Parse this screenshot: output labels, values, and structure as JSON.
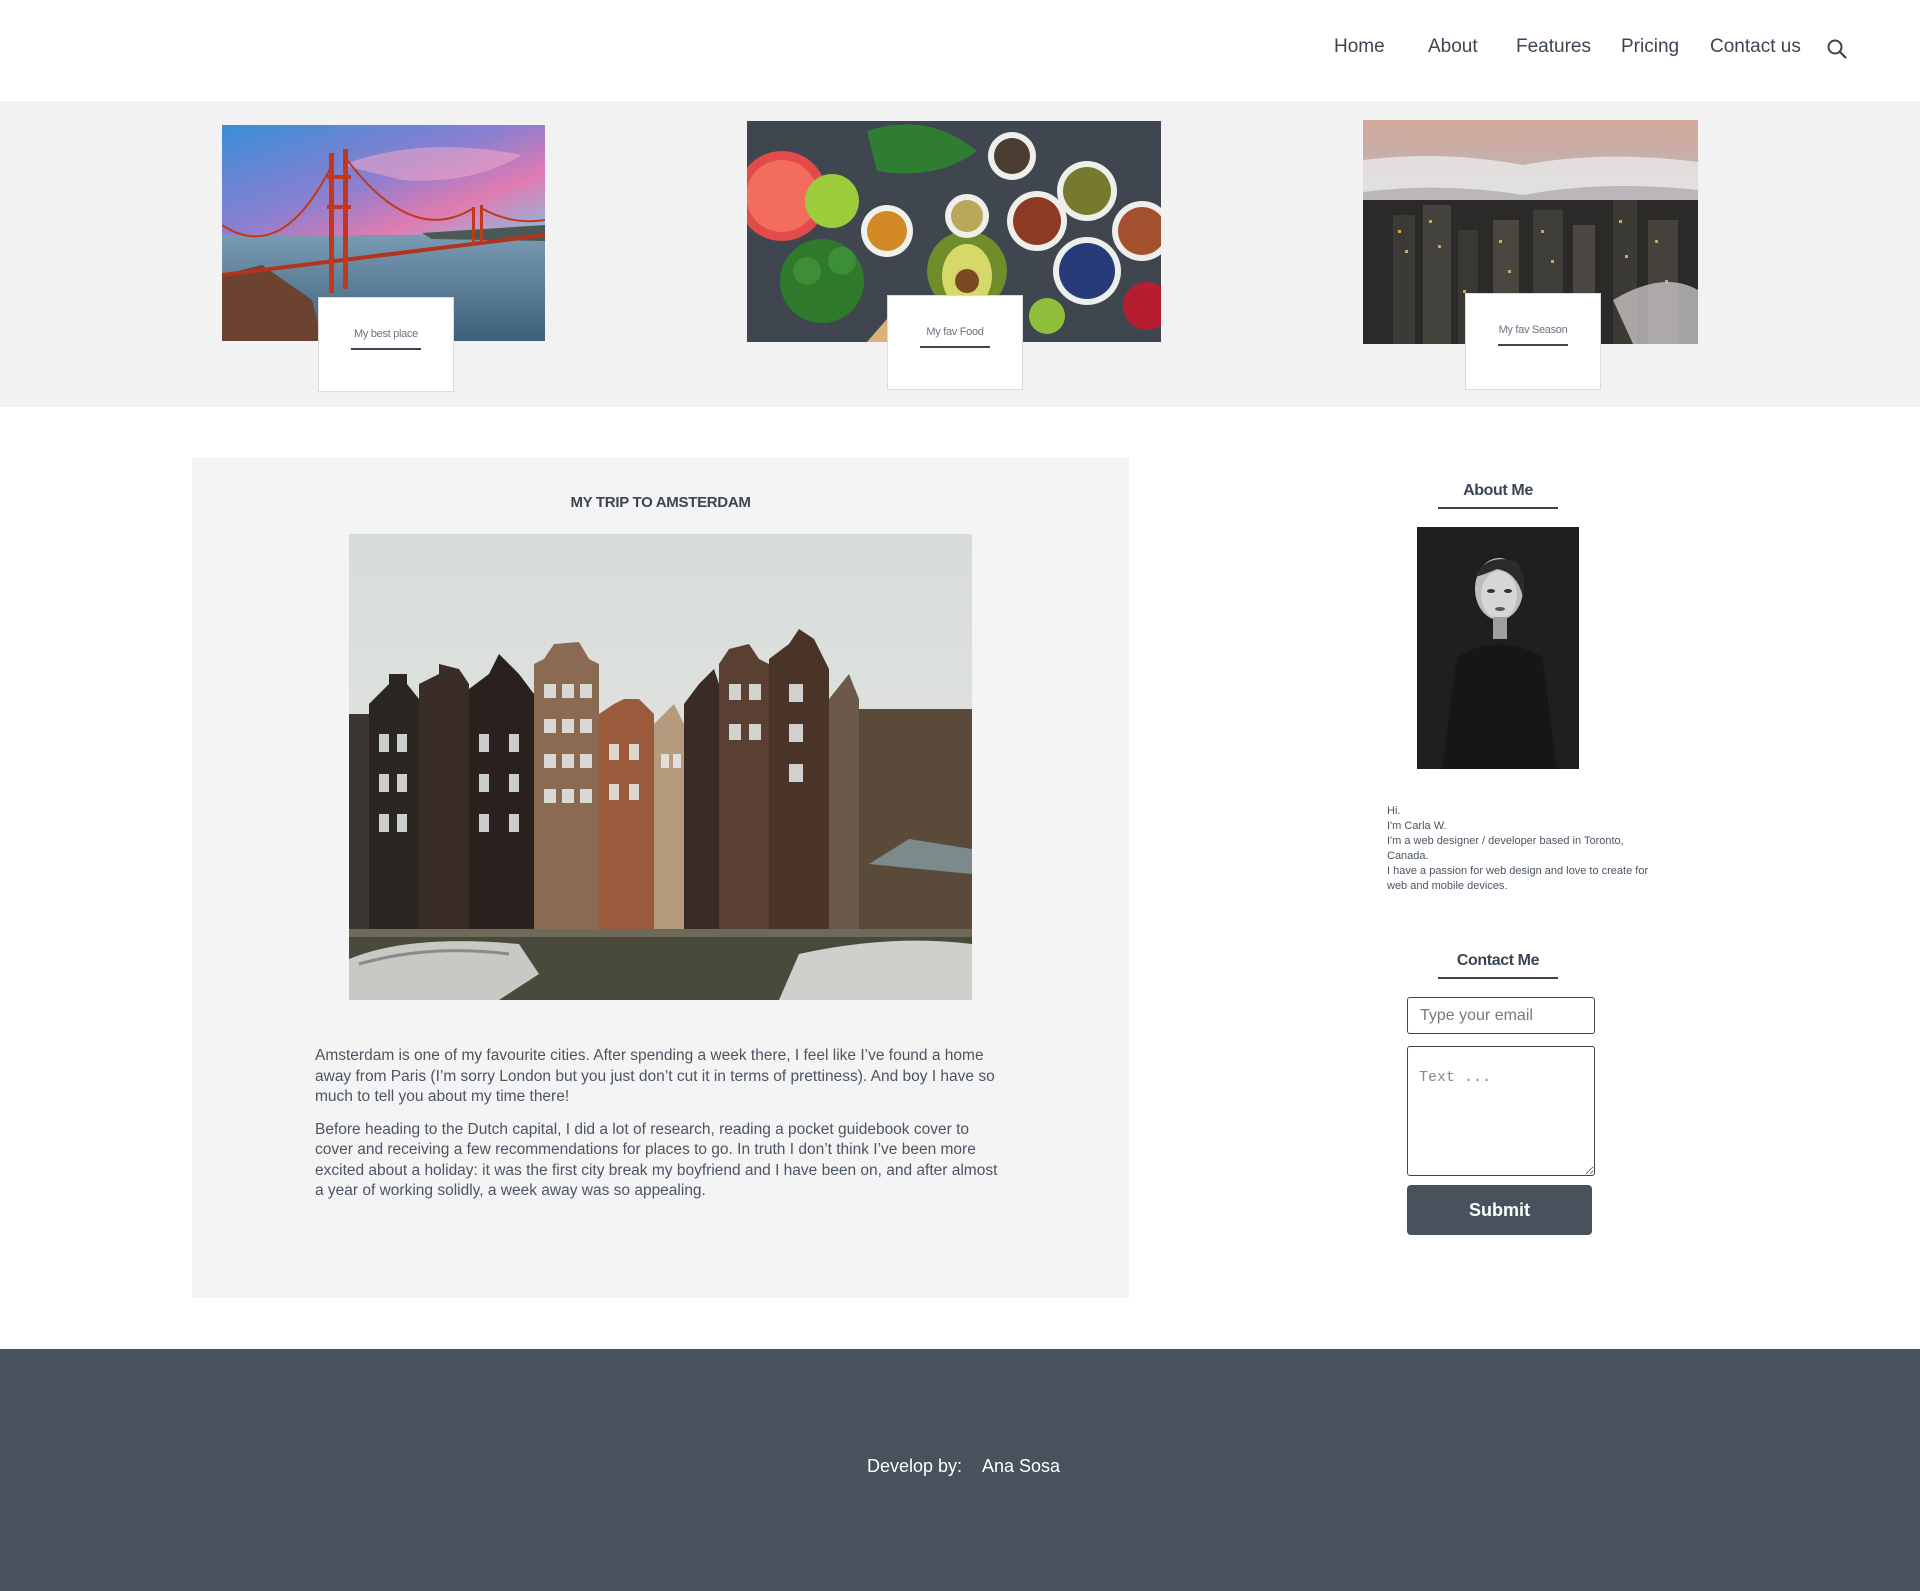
{
  "nav": {
    "items": [
      {
        "label": "Home"
      },
      {
        "label": "About"
      },
      {
        "label": "Features"
      },
      {
        "label": "Pricing"
      },
      {
        "label": "Contact us"
      }
    ],
    "search_icon": "search-icon"
  },
  "featured": {
    "cards": [
      {
        "label": "My best place",
        "image": "golden-gate-bridge-image"
      },
      {
        "label": "My fav Food",
        "image": "healthy-food-image"
      },
      {
        "label": "My fav Season",
        "image": "foggy-city-image"
      }
    ]
  },
  "article": {
    "title": "MY TRIP TO AMSTERDAM",
    "image": "amsterdam-canal-houses-image",
    "paragraphs": [
      "Amsterdam is one of my favourite cities. After spending a week there, I feel like I’ve found a home away from Paris (I’m sorry London but you just don’t cut it in terms of prettiness). And boy I have so much to tell you about my time there!",
      "Before heading to the Dutch capital, I did a lot of research, reading a pocket guidebook cover to cover and receiving a few recommendations for places to go. In truth I don’t think I’ve been more excited about a holiday: it was the first city break my boyfriend and I have been on, and after almost a year of working solidly, a week away was so appealing."
    ]
  },
  "sidebar": {
    "about_heading": "About Me",
    "portrait": "portrait-image",
    "bio": [
      "Hi.",
      "I'm Carla W.",
      "I'm a web designer / developer based in Toronto, Canada.",
      "I have a passion for web design and love to create for web and mobile devices."
    ],
    "contact_heading": "Contact Me",
    "email_placeholder": "Type your email",
    "text_placeholder": "Text ...",
    "submit_label": "Submit"
  },
  "footer": {
    "label": "Develop by:",
    "name": "Ana Sosa"
  },
  "colors": {
    "text": "#3c4652",
    "footer_bg": "#47525d",
    "strip_bg": "#f2f2f2",
    "card_bg": "#f4f4f4",
    "button_bg": "#47525d"
  }
}
